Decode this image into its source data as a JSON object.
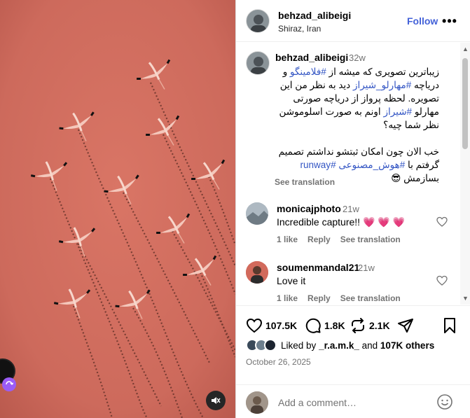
{
  "header": {
    "username": "behzad_alibeigi",
    "location": "Shiraz, Iran",
    "follow_label": "Follow",
    "more_icon": "more-horizontal-icon"
  },
  "caption": {
    "username": "behzad_alibeigi",
    "time": "32w",
    "line1": "زیباترین تصویری که میشه از #فلامینگو و",
    "line2": "دریاچه #مهارلو_شیراز دید به نظر من این",
    "line3": "تصویره. لحظه پرواز از دریاچه صورتی",
    "line4": "مهارلو #شیراز اونم به صورت اسلوموشن",
    "line5": "نظر شما چیه؟",
    "line6": "خب الان چون امکان ثبتشو نداشتم تصمیم",
    "line7": "گرفتم با #هوش_مصنوعی #runway",
    "line8": "بسازمش 😎",
    "see_translation": "See translation"
  },
  "comments": [
    {
      "username": "monicajphoto",
      "time": "21w",
      "text": "Incredible capture!! 💗 💗 💗",
      "likes": "1 like",
      "reply": "Reply",
      "see_translation": "See translation"
    },
    {
      "username": "soumenmandal21",
      "time": "21w",
      "text": "Love it",
      "likes": "1 like",
      "reply": "Reply",
      "see_translation": "See translation"
    }
  ],
  "actions": {
    "likes_count": "107.5K",
    "comments_count": "1.8K",
    "reposts_count": "2.1K",
    "liked_by_prefix": "Liked by",
    "liked_by_user": "_r.a.m.k_",
    "liked_by_and": "and",
    "liked_by_others": "107K others",
    "date": "October 26, 2025"
  },
  "add_comment": {
    "placeholder": "Add a comment…"
  },
  "colors": {
    "accent": "#4361d8",
    "hashtag": "#3456c4",
    "lake": "#cf6e60",
    "muted": "#737373"
  }
}
